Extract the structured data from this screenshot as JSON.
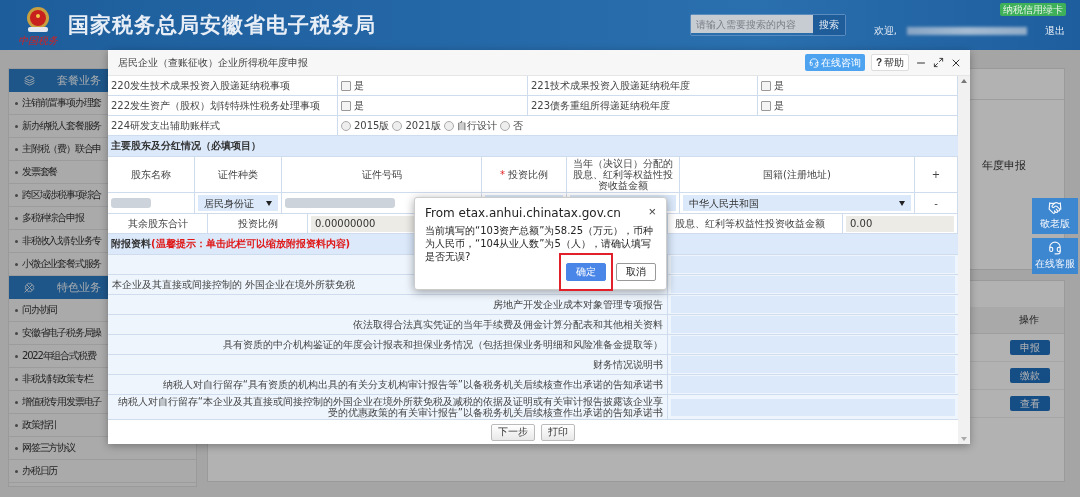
{
  "header": {
    "logo_text": "中国税务",
    "title": "国家税务总局安徽省电子税务局",
    "search": {
      "placeholder": "请输入需要搜索的内容",
      "button": "搜索"
    },
    "welcome": "欢迎,",
    "logout": "退出",
    "badge": "纳税信用绿卡"
  },
  "sidebar": [
    {
      "title": "套餐业务",
      "kind": "bundle",
      "items": [
        "注销前置事项办理套",
        "新办纳税人套餐服务",
        "主附税（费）联合申",
        "发票套餐",
        "跨区域涉税事项综合",
        "多税种综合申报",
        "非税收入划转业务专",
        "小微企业套餐式服务"
      ]
    },
    {
      "title": "特色业务",
      "kind": "featured",
      "items": [
        "问办协同",
        "安徽省电子税务局操",
        "2022年组合式税费",
        "非税划转政策专栏",
        "增值税专用发票电子",
        "政策指引",
        "网签三方协议",
        "办税日历"
      ]
    }
  ],
  "main": {
    "card_title": "年度申报",
    "column": "操作",
    "actions": [
      "申报",
      "缴款",
      "查看"
    ]
  },
  "float_buttons": [
    {
      "label": "敬老版",
      "kind": "elder"
    },
    {
      "label": "在线客服",
      "kind": "service"
    }
  ],
  "modal": {
    "title": "居民企业（查账征收）企业所得税年度申报",
    "consult": "在线咨询",
    "help_mark": "?",
    "help": "帮助",
    "questions": [
      [
        {
          "label": "220发生技术成果投资入股递延纳税事项",
          "option": "是",
          "checked": false
        },
        {
          "label": "221技术成果投资入股递延纳税年度",
          "option": "是",
          "checked": false
        }
      ],
      [
        {
          "label": "222发生资产（股权）划转特殊性税务处理事项",
          "option": "是",
          "checked": false
        },
        {
          "label": "223债务重组所得递延纳税年度",
          "option": "是",
          "checked": false
        }
      ]
    ],
    "style_question": {
      "label": "224研发支出辅助账样式",
      "options": [
        {
          "label": "2015版",
          "selected": false
        },
        {
          "label": "2021版",
          "selected": false
        },
        {
          "label": "自行设计",
          "selected": false
        },
        {
          "label": "否",
          "selected": false
        }
      ]
    },
    "shareholders": {
      "title": "主要股东及分红情况（必填项目）",
      "columns": [
        {
          "label": "股东名称"
        },
        {
          "label": "证件种类"
        },
        {
          "label": "证件号码"
        },
        {
          "label": "投资比例",
          "required_mark": "*"
        },
        {
          "label": "当年（决议日）分配的股息、红利等权益性投资收益金额"
        },
        {
          "label": "国籍(注册地址)"
        }
      ],
      "add": "+",
      "rows": [
        {
          "id_type": "居民身份证",
          "country": "中华人民共和国",
          "remove": "-"
        }
      ],
      "others": {
        "label": "其余股东合计",
        "ratio_label": "投资比例",
        "ratio": "0.00000000",
        "dividend_label": "股息、红利等权益性投资收益金额",
        "dividend": "0.00"
      }
    },
    "attachments": {
      "title": "附报资料",
      "hint": "(温馨提示：单击此栏可以缩放附报资料内容)",
      "items": [
        {
          "kind": "blank"
        },
        {
          "kind": "partial",
          "label": "本企业及其直接或间接控制的 外国企业在境外所获免税"
        },
        {
          "kind": "full",
          "label": "房地产开发企业成本对象管理专项报告"
        },
        {
          "kind": "full",
          "label": "依法取得合法真实凭证的当年手续费及佣金计算分配表和其他相关资料"
        },
        {
          "kind": "full",
          "label": "具有资质的中介机构鉴证的年度会计报表和担保业务情况（包括担保业务明细和风险准备金提取等）"
        },
        {
          "kind": "full",
          "label": "财务情况说明书"
        },
        {
          "kind": "full",
          "label": "纳税人对自行留存“具有资质的机构出具的有关分支机构审计报告等”以备税务机关后续核查作出承诺的告知承诺书"
        },
        {
          "kind": "full",
          "label": "纳税人对自行留存“本企业及其直接或间接控制的外国企业在境外所获免税及减税的依据及证明或有关审计报告披露该企业享受的优惠政策的有关审计报告”以备税务机关后续核查作出承诺的告知承诺书"
        }
      ]
    },
    "buttons": [
      "下一步",
      "打印"
    ]
  },
  "alert": {
    "origin": "From etax.anhui.chinatax.gov.cn",
    "close": "×",
    "message": "当前填写的“103资产总额”为58.25（万元），币种为人民币，“104从业人数”为5（人），请确认填写是否无误?",
    "buttons": [
      {
        "label": "确定",
        "highlighted": true
      },
      {
        "label": "取消",
        "highlighted": false
      }
    ]
  }
}
